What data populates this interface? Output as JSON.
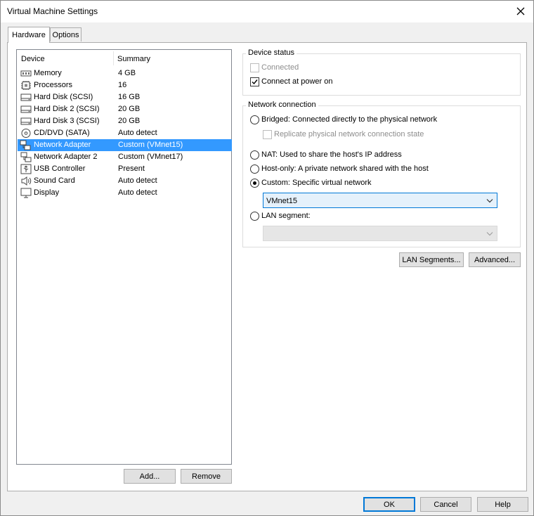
{
  "window": {
    "title": "Virtual Machine Settings"
  },
  "tabs": [
    {
      "label": "Hardware",
      "active": true
    },
    {
      "label": "Options",
      "active": false
    }
  ],
  "device_list": {
    "columns": {
      "device": "Device",
      "summary": "Summary"
    },
    "rows": [
      {
        "device": "Memory",
        "summary": "4 GB",
        "icon": "memory-icon"
      },
      {
        "device": "Processors",
        "summary": "16",
        "icon": "processor-icon"
      },
      {
        "device": "Hard Disk (SCSI)",
        "summary": "16 GB",
        "icon": "hard-disk-icon"
      },
      {
        "device": "Hard Disk 2 (SCSI)",
        "summary": "20 GB",
        "icon": "hard-disk-icon"
      },
      {
        "device": "Hard Disk 3 (SCSI)",
        "summary": "20 GB",
        "icon": "hard-disk-icon"
      },
      {
        "device": "CD/DVD (SATA)",
        "summary": "Auto detect",
        "icon": "cd-dvd-icon"
      },
      {
        "device": "Network Adapter",
        "summary": "Custom (VMnet15)",
        "icon": "network-adapter-icon",
        "selected": true
      },
      {
        "device": "Network Adapter 2",
        "summary": "Custom (VMnet17)",
        "icon": "network-adapter-icon"
      },
      {
        "device": "USB Controller",
        "summary": "Present",
        "icon": "usb-icon"
      },
      {
        "device": "Sound Card",
        "summary": "Auto detect",
        "icon": "speaker-icon"
      },
      {
        "device": "Display",
        "summary": "Auto detect",
        "icon": "monitor-icon"
      }
    ],
    "add_label": "Add...",
    "remove_label": "Remove"
  },
  "device_status": {
    "legend": "Device status",
    "connected_label": "Connected",
    "connected_checked": false,
    "connect_at_power_on_label": "Connect at power on",
    "connect_at_power_on_checked": true
  },
  "network_connection": {
    "legend": "Network connection",
    "bridged_label": "Bridged: Connected directly to the physical network",
    "replicate_label": "Replicate physical network connection state",
    "nat_label": "NAT: Used to share the host's IP address",
    "host_only_label": "Host-only: A private network shared with the host",
    "custom_label": "Custom: Specific virtual network",
    "selected": "custom",
    "custom_network_value": "VMnet15",
    "lan_segment_label": "LAN segment:",
    "lan_segment_value": ""
  },
  "actions": {
    "lan_segments_label": "LAN Segments...",
    "advanced_label": "Advanced..."
  },
  "footer": {
    "ok_label": "OK",
    "cancel_label": "Cancel",
    "help_label": "Help"
  },
  "colors": {
    "selection": "#3399ff",
    "focus": "#0078d7"
  }
}
